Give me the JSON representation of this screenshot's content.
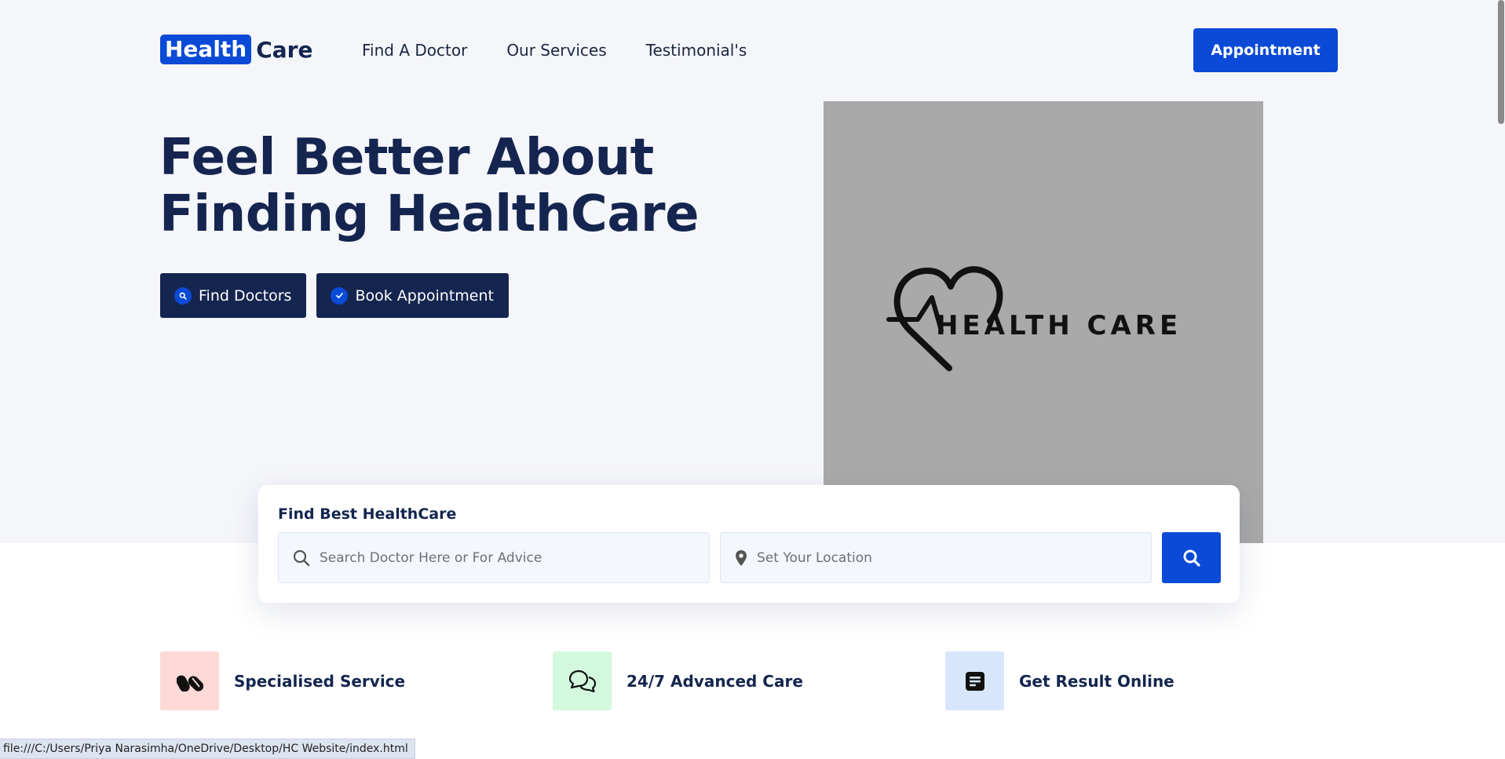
{
  "header": {
    "logo_highlight": "Health",
    "logo_rest": "Care",
    "nav": [
      "Find A Doctor",
      "Our Services",
      "Testimonial's"
    ],
    "appointment_label": "Appointment"
  },
  "hero": {
    "title_line1": "Feel Better About",
    "title_line2": "Finding HealthCare",
    "find_doctors_label": "Find Doctors",
    "book_appointment_label": "Book Appointment",
    "image_text": "HEALTH CARE"
  },
  "search": {
    "title": "Find Best HealthCare",
    "doctor_placeholder": "Search Doctor Here or For Advice",
    "location_placeholder": "Set Your Location"
  },
  "features": [
    {
      "label": "Specialised Service",
      "icon": "pills-icon",
      "tile_color": "#fdd9d5"
    },
    {
      "label": "24/7 Advanced Care",
      "icon": "chat-bubbles-icon",
      "tile_color": "#d3f8dd"
    },
    {
      "label": "Get Result Online",
      "icon": "document-icon",
      "tile_color": "#d7e6fb"
    }
  ],
  "colors": {
    "brand_blue": "#0a4ad6",
    "navy": "#14254f",
    "hero_bg": "#f5f6fa"
  },
  "status_bar": {
    "url": "file:///C:/Users/Priya Narasimha/OneDrive/Desktop/HC Website/index.html"
  }
}
